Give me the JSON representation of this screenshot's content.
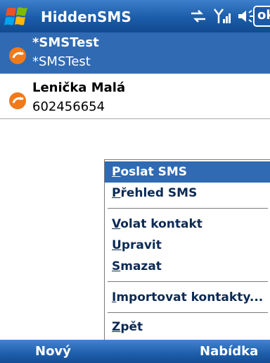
{
  "titlebar": {
    "title": "HiddenSMS",
    "ok_label": "ok",
    "icons": [
      "windows-start-icon",
      "connectivity-icon",
      "signal-icon",
      "volume-icon"
    ]
  },
  "contacts": [
    {
      "name": "*SMSTest",
      "number": "*SMSTest",
      "selected": true
    },
    {
      "name": "Lenička Malá",
      "number": "602456654",
      "selected": false
    }
  ],
  "menu": {
    "items": [
      {
        "key": "P",
        "rest": "oslat SMS",
        "highlighted": true
      },
      {
        "key": "P",
        "rest": "řehled SMS"
      },
      {
        "key": "V",
        "rest": "olat kontakt"
      },
      {
        "key": "U",
        "rest": "pravit"
      },
      {
        "key": "S",
        "rest": "mazat"
      },
      {
        "key": "I",
        "rest": "mportovat kontakty..."
      },
      {
        "key": "Z",
        "rest": "pět"
      }
    ]
  },
  "softkeys": {
    "left": "Nový",
    "right": "Nabídka"
  },
  "colors": {
    "accent": "#2f6ab3",
    "titlebar": "#1b5ca9",
    "menu_text": "#0b2a55",
    "avatar": "#f07a1a"
  }
}
